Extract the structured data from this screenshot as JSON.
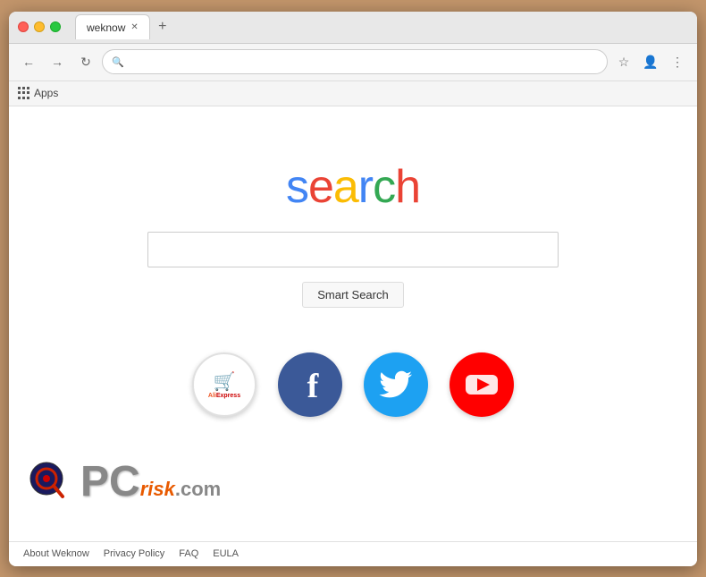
{
  "browser": {
    "tab_title": "weknow",
    "address_value": "",
    "address_placeholder": ""
  },
  "bookmarks": {
    "apps_label": "Apps"
  },
  "page": {
    "logo_letters": [
      "s",
      "e",
      "a",
      "r",
      "c",
      "h"
    ],
    "search_button_label": "Smart Search",
    "search_placeholder": ""
  },
  "quick_links": [
    {
      "id": "aliexpress",
      "label": "AliExpress"
    },
    {
      "id": "facebook",
      "label": "Facebook"
    },
    {
      "id": "twitter",
      "label": "Twitter"
    },
    {
      "id": "youtube",
      "label": "YouTube"
    }
  ],
  "watermark": {
    "site": "PCrisk.com"
  },
  "footer": {
    "links": [
      "About Weknow",
      "Privacy Policy",
      "FAQ",
      "EULA"
    ]
  }
}
